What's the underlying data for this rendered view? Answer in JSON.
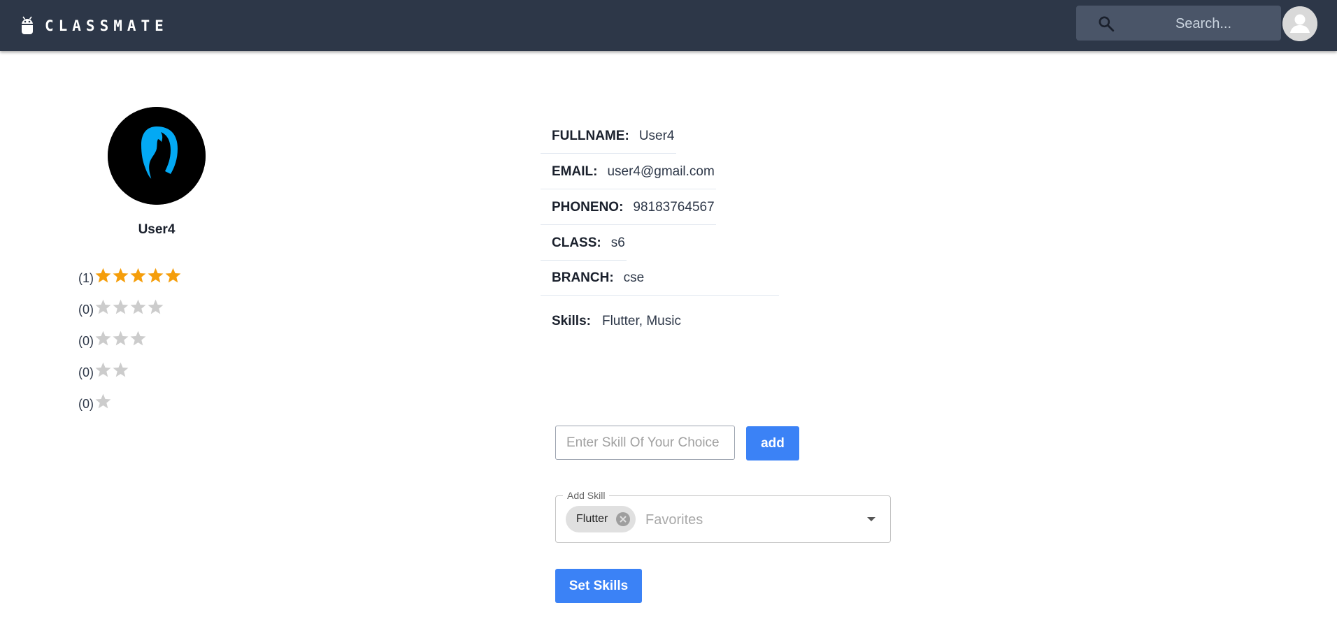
{
  "navbar": {
    "brand": "CLASSMATE",
    "search_placeholder": "Search...",
    "background": "#2d3748"
  },
  "profile": {
    "name": "User4",
    "ratings": [
      {
        "count": "(1)",
        "stars": 5,
        "color": "#f59e0b"
      },
      {
        "count": "(0)",
        "stars": 4,
        "color": "#cccccc"
      },
      {
        "count": "(0)",
        "stars": 3,
        "color": "#cccccc"
      },
      {
        "count": "(0)",
        "stars": 2,
        "color": "#cccccc"
      },
      {
        "count": "(0)",
        "stars": 1,
        "color": "#cccccc"
      }
    ]
  },
  "info": {
    "fullname_label": "FULLNAME:",
    "fullname": "User4",
    "email_label": "EMAIL:",
    "email": "user4@gmail.com",
    "phone_label": "PHONENO:",
    "phone": "98183764567",
    "class_label": "CLASS:",
    "class": "s6",
    "branch_label": "BRANCH:",
    "branch": "cse",
    "skills_label": "Skills:",
    "skills": "Flutter, Music"
  },
  "skill_form": {
    "input_placeholder": "Enter Skill Of Your Choice",
    "add_label": "add",
    "select_legend": "Add Skill",
    "chips": [
      "Flutter"
    ],
    "select_placeholder": "Favorites",
    "set_label": "Set Skills",
    "accent": "#3b82f6"
  }
}
